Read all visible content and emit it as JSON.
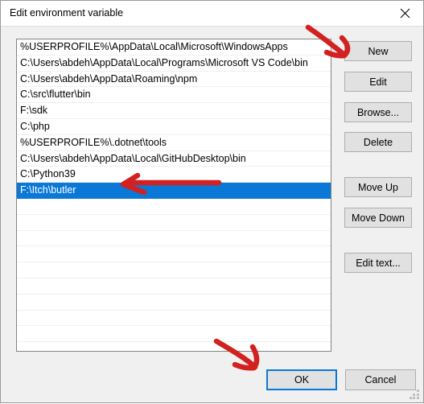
{
  "window": {
    "title": "Edit environment variable",
    "close_icon": "close-icon"
  },
  "list": {
    "items": [
      "%USERPROFILE%\\AppData\\Local\\Microsoft\\WindowsApps",
      "C:\\Users\\abdeh\\AppData\\Local\\Programs\\Microsoft VS Code\\bin",
      "C:\\Users\\abdeh\\AppData\\Roaming\\npm",
      "C:\\src\\flutter\\bin",
      "F:\\sdk",
      "C:\\php",
      "%USERPROFILE%\\.dotnet\\tools",
      "C:\\Users\\abdeh\\AppData\\Local\\GitHubDesktop\\bin",
      "C:\\Python39",
      "F:\\Itch\\butler"
    ],
    "selected_index": 9,
    "selected_value": "F:\\Itch\\butler",
    "selection_color": "#0a78d7"
  },
  "side_buttons": [
    {
      "id": "new",
      "label": "New"
    },
    {
      "id": "edit",
      "label": "Edit"
    },
    {
      "id": "browse",
      "label": "Browse..."
    },
    {
      "id": "delete",
      "label": "Delete"
    },
    {
      "id": "move_up",
      "label": "Move Up"
    },
    {
      "id": "move_down",
      "label": "Move Down"
    },
    {
      "id": "edit_text",
      "label": "Edit text..."
    }
  ],
  "footer": {
    "ok_label": "OK",
    "cancel_label": "Cancel",
    "focus_color": "#0a78d7"
  },
  "annotations": {
    "color": "#d32020",
    "marks": [
      {
        "name": "arrow-to-new-button",
        "target": "New"
      },
      {
        "name": "arrow-to-selected-row",
        "target": "F:\\Itch\\butler"
      },
      {
        "name": "arrow-to-ok-button",
        "target": "OK"
      }
    ]
  }
}
